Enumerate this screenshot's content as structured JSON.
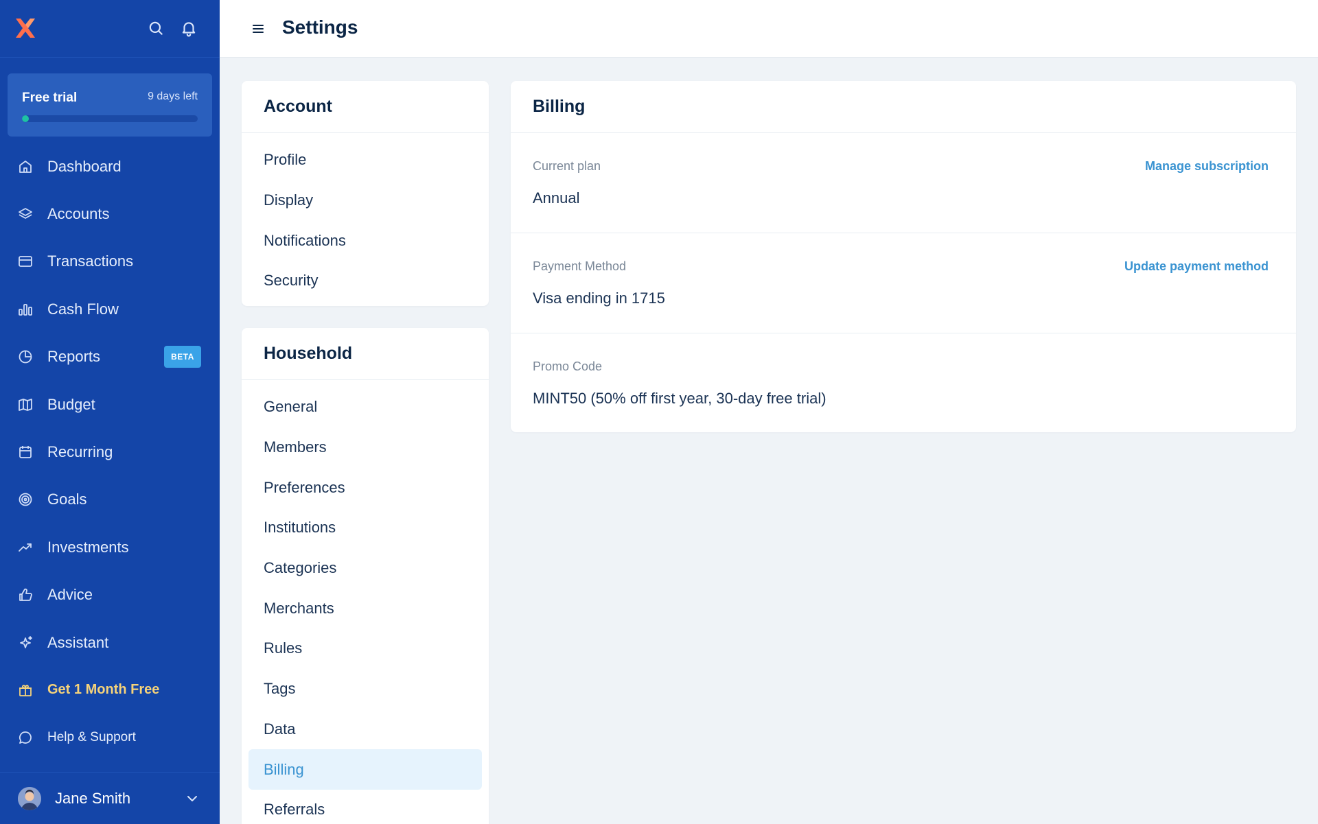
{
  "sidebar": {
    "trial": {
      "title": "Free trial",
      "days_left": "9 days left",
      "progress": 0.03
    },
    "items": [
      {
        "label": "Dashboard",
        "icon": "home-icon"
      },
      {
        "label": "Accounts",
        "icon": "layers-icon"
      },
      {
        "label": "Transactions",
        "icon": "credit-card-icon"
      },
      {
        "label": "Cash Flow",
        "icon": "bar-chart-icon"
      },
      {
        "label": "Reports",
        "icon": "pie-chart-icon",
        "badge": "BETA"
      },
      {
        "label": "Budget",
        "icon": "map-icon"
      },
      {
        "label": "Recurring",
        "icon": "calendar-icon"
      },
      {
        "label": "Goals",
        "icon": "target-icon"
      },
      {
        "label": "Investments",
        "icon": "trending-up-icon"
      },
      {
        "label": "Advice",
        "icon": "thumbs-up-icon"
      },
      {
        "label": "Assistant",
        "icon": "sparkle-icon"
      },
      {
        "label": "Get 1 Month Free",
        "icon": "gift-icon"
      },
      {
        "label": "Help & Support",
        "icon": "chat-bubble-icon"
      }
    ],
    "user": {
      "name": "Jane Smith"
    }
  },
  "header": {
    "title": "Settings"
  },
  "account_card": {
    "title": "Account",
    "items": [
      "Profile",
      "Display",
      "Notifications",
      "Security"
    ]
  },
  "household_card": {
    "title": "Household",
    "items": [
      "General",
      "Members",
      "Preferences",
      "Institutions",
      "Categories",
      "Merchants",
      "Rules",
      "Tags",
      "Data",
      "Billing",
      "Referrals"
    ],
    "active": "Billing"
  },
  "billing": {
    "title": "Billing",
    "rows": [
      {
        "label": "Current plan",
        "value": "Annual",
        "action": "Manage subscription"
      },
      {
        "label": "Payment Method",
        "value": "Visa ending in 1715",
        "action": "Update payment method"
      },
      {
        "label": "Promo Code",
        "value": "MINT50 (50% off first year, 30-day free trial)",
        "action": ""
      }
    ]
  },
  "colors": {
    "sidebar_bg": "#1445a8",
    "accent": "#3a93d1",
    "promo": "#f6d37a",
    "progress": "#1ec3a3"
  }
}
